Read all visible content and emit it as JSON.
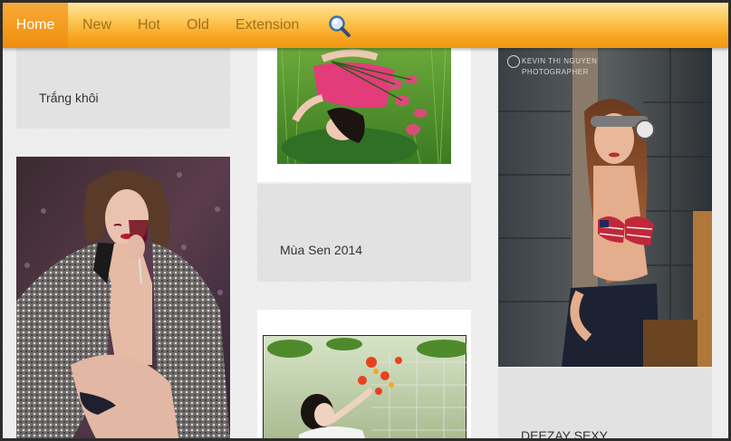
{
  "nav": {
    "items": [
      {
        "label": "Home"
      },
      {
        "label": "New"
      },
      {
        "label": "Hot"
      },
      {
        "label": "Old"
      },
      {
        "label": "Extension"
      }
    ],
    "active_index": 0,
    "search_icon": "search-icon"
  },
  "albums": [
    {
      "title": "Trắng khôi"
    },
    {
      "title": "Mùa Sen 2014"
    },
    {
      "title": "DEEZAY SEXY"
    },
    {
      "title": ""
    },
    {
      "title": ""
    }
  ],
  "photos": {
    "watermark_text": "KEVIN THI NGUYEN",
    "watermark_sub": "PHOTOGRAPHER"
  },
  "colors": {
    "nav_accent": "#f39a1c",
    "nav_active_text": "#ffffff",
    "nav_text": "#a06f1e",
    "card_bg": "#e2e2e2"
  }
}
